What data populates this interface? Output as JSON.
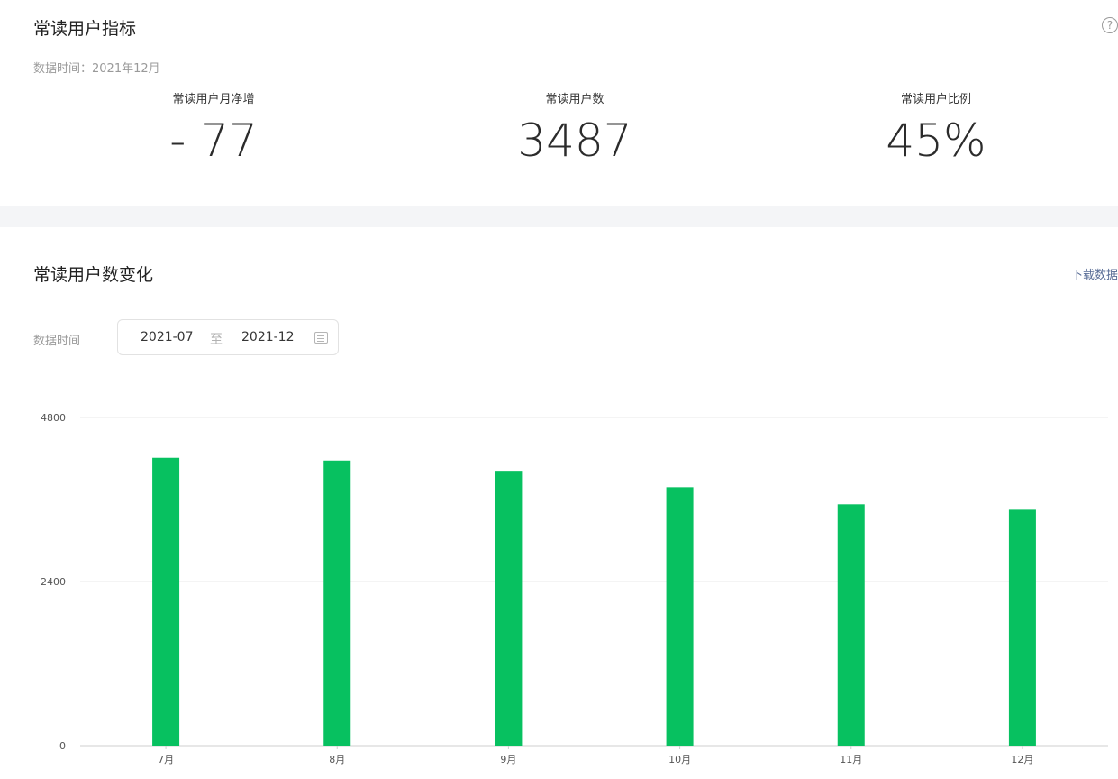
{
  "header": {
    "title": "常读用户指标",
    "help_icon": "question-circle-icon",
    "data_time": "数据时间：2021年12月"
  },
  "metrics": [
    {
      "label": "常读用户月净增",
      "value": "- 77"
    },
    {
      "label": "常读用户数",
      "value": "3487"
    },
    {
      "label": "常读用户比例",
      "value": "45%"
    }
  ],
  "chart_section": {
    "title": "常读用户数变化",
    "download_label": "下载数据",
    "range_label": "数据时间",
    "start": "2021-07",
    "separator": "至",
    "end": "2021-12",
    "calendar_icon": "calendar-icon"
  },
  "colors": {
    "bar": "#07c160",
    "link": "#576b95",
    "band": "#f4f5f7"
  },
  "chart_data": {
    "type": "bar",
    "categories": [
      "7月",
      "8月",
      "9月",
      "10月",
      "11月",
      "12月"
    ],
    "values": [
      4210,
      4170,
      4020,
      3780,
      3530,
      3450
    ],
    "yticks": [
      0,
      2400,
      4800
    ],
    "ylim": [
      0,
      4800
    ],
    "grid": true
  }
}
